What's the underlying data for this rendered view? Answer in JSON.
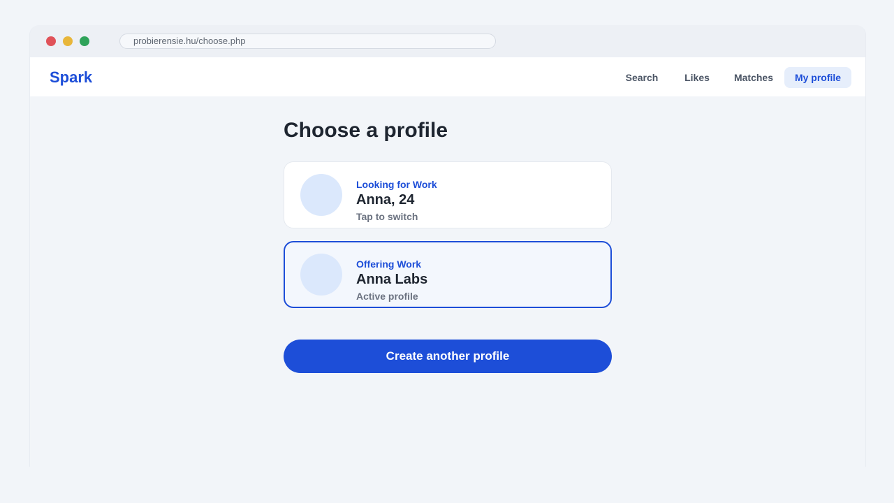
{
  "browser": {
    "url": "probierensie.hu/choose.php",
    "controls": [
      "close",
      "minimize",
      "maximize"
    ]
  },
  "navbar": {
    "logo": "Spark",
    "links": [
      {
        "label": "Search",
        "active": false
      },
      {
        "label": "Likes",
        "active": false
      },
      {
        "label": "Matches",
        "active": false
      },
      {
        "label": "My profile",
        "active": true
      }
    ]
  },
  "main": {
    "title": "Choose a profile",
    "profiles": [
      {
        "type": "Looking for Work",
        "name": "Anna, 24",
        "subtitle": "Tap to switch",
        "selected": false
      },
      {
        "type": "Offering Work",
        "name": "Anna Labs",
        "subtitle": "Active profile",
        "selected": true
      }
    ],
    "create_button": "Create another profile"
  },
  "colors": {
    "accent": "#1d4ed8",
    "background": "#f2f5f9",
    "avatar": "#dbe8fc",
    "close_dot": "#e05259",
    "minimize_dot": "#e8b63a",
    "maximize_dot": "#2fa35a"
  }
}
